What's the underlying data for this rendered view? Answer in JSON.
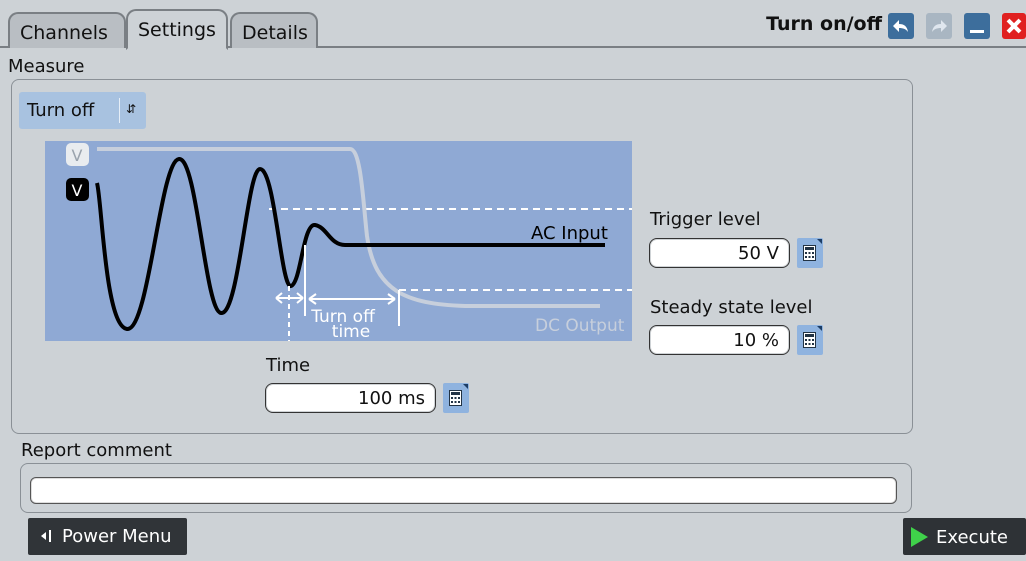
{
  "tabs": [
    {
      "label": "Channels"
    },
    {
      "label": "Settings",
      "active": true
    },
    {
      "label": "Details"
    }
  ],
  "window": {
    "title": "Turn on/off"
  },
  "measure": {
    "section_label": "Measure",
    "mode_select": {
      "value": "Turn off"
    },
    "diagram": {
      "badge_top": "V",
      "badge_bottom": "V",
      "ac_label": "AC Input",
      "dc_label": "DC Output",
      "turn_off_label_1": "Turn off",
      "turn_off_label_2": "time"
    },
    "trigger_level": {
      "label": "Trigger level",
      "value": "50 V"
    },
    "steady_state_level": {
      "label": "Steady state level",
      "value": "10 %"
    },
    "time": {
      "label": "Time",
      "value": "100 ms"
    }
  },
  "report": {
    "section_label": "Report comment",
    "value": ""
  },
  "footer": {
    "power_menu_label": "Power Menu",
    "execute_label": "Execute"
  },
  "colors": {
    "accent": "#3d6e9c",
    "close": "#e02020",
    "diagram_bg": "#8fa9d4",
    "execute_icon": "#3fd14a"
  }
}
